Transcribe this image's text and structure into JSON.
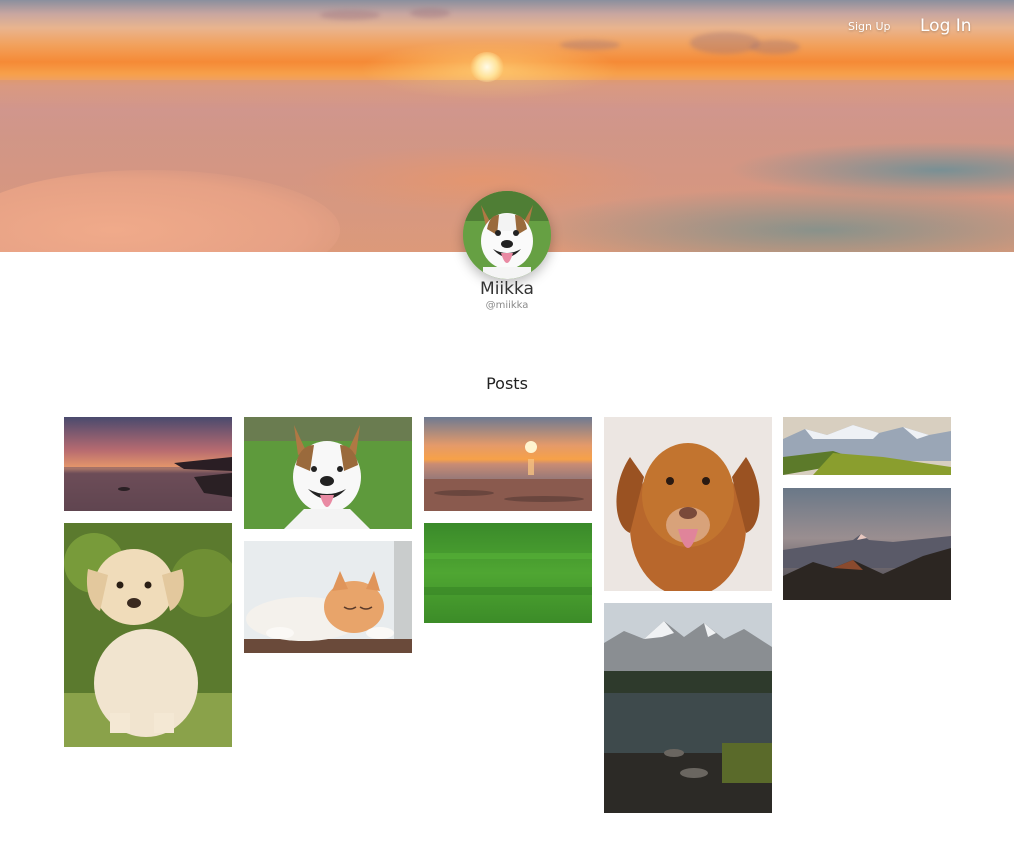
{
  "nav": {
    "signup_label": "Sign Up",
    "login_label": "Log In"
  },
  "profile": {
    "name": "Miikka",
    "handle": "@miikka"
  },
  "posts": {
    "title": "Posts",
    "items": [
      {
        "subject": "sunset-lake-photo"
      },
      {
        "subject": "puppy-labrador-photo"
      },
      {
        "subject": "smiling-dog-photo"
      },
      {
        "subject": "sleeping-cat-photo"
      },
      {
        "subject": "beach-sunset-photo"
      },
      {
        "subject": "green-grass-photo"
      },
      {
        "subject": "brown-dog-photo"
      },
      {
        "subject": "mountain-lake-photo"
      },
      {
        "subject": "snowy-mountains-photo"
      },
      {
        "subject": "mountain-dusk-photo"
      }
    ]
  },
  "colors": {
    "accent": "#f58a36",
    "text": "#222222",
    "muted": "#8a8a8a"
  }
}
